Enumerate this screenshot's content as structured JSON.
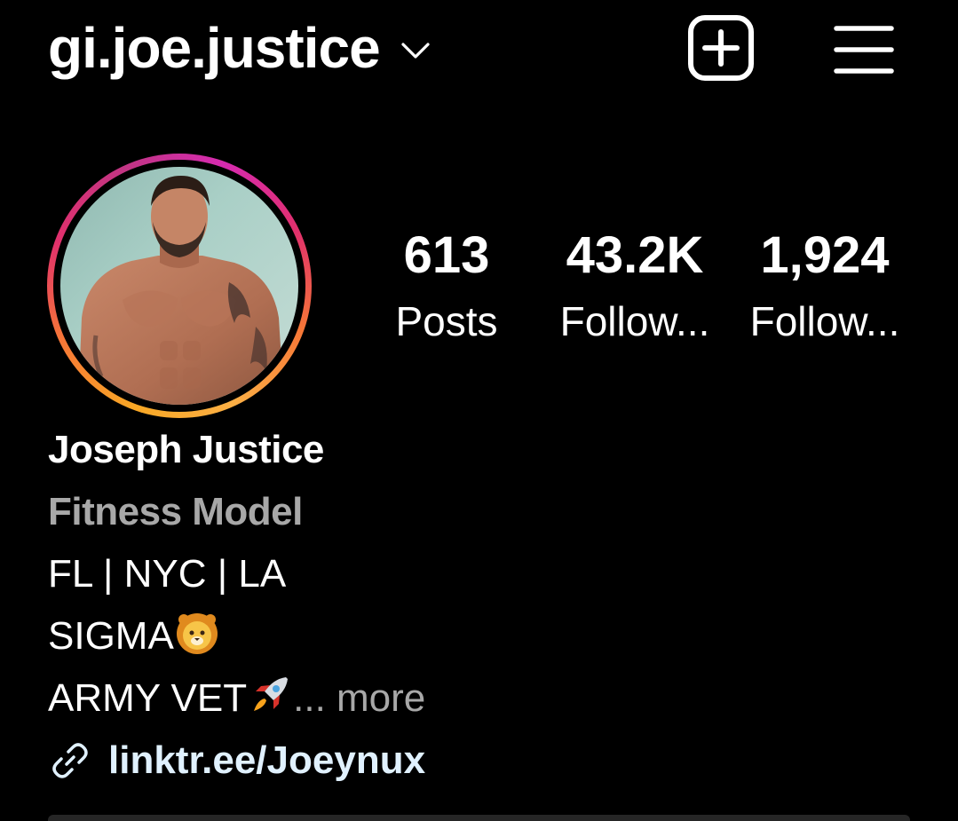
{
  "header": {
    "username": "gi.joe.justice",
    "chevron_icon": "chevron-down-icon",
    "new_post_icon": "plus-square-icon",
    "menu_icon": "hamburger-menu-icon"
  },
  "avatar": {
    "ring_colors": [
      "#fcaf45",
      "#f77737",
      "#e1306c",
      "#c13584"
    ]
  },
  "stats": [
    {
      "value": "613",
      "label": "Posts"
    },
    {
      "value": "43.2K",
      "label": "Follow..."
    },
    {
      "value": "1,924",
      "label": "Follow..."
    }
  ],
  "bio": {
    "full_name": "Joseph Justice",
    "category": "Fitness Model",
    "lines": [
      "FL | NYC | LA",
      "SIGMA",
      "ARMY VET"
    ],
    "line2_emoji": "lion-face-emoji",
    "line3_emoji": "rocket-emoji",
    "more_label": "... more",
    "link_icon": "link-icon",
    "link_text": "linktr.ee/Joeynux"
  },
  "colors": {
    "background": "#000000",
    "text": "#ffffff",
    "secondary_text": "#a8a8a8",
    "link_text": "#e0f1ff"
  }
}
